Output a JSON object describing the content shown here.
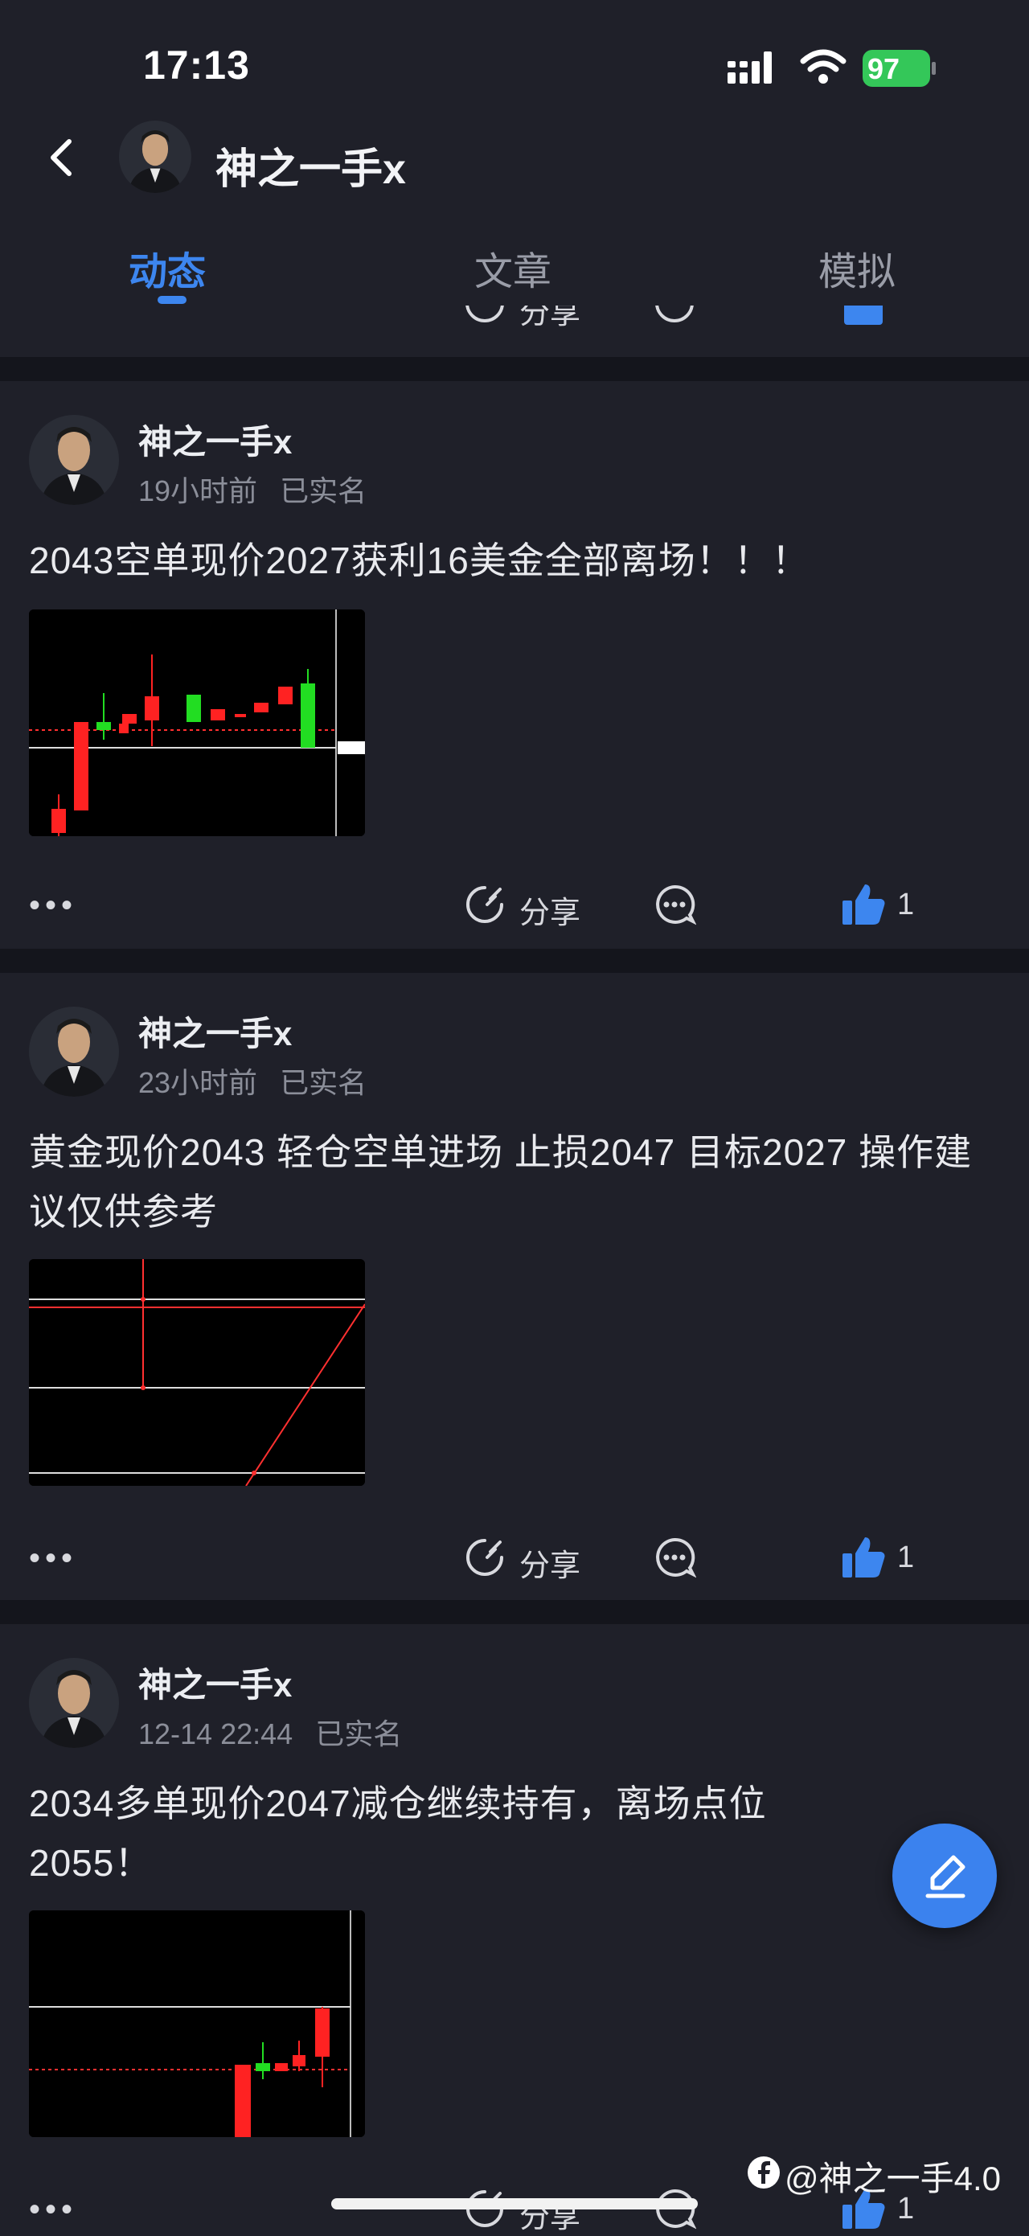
{
  "status_bar": {
    "time": "17:13",
    "battery": "97"
  },
  "header": {
    "title": "神之一手x"
  },
  "tabs": [
    {
      "label": "动态",
      "active": true
    },
    {
      "label": "文章",
      "active": false
    },
    {
      "label": "模拟",
      "active": false
    }
  ],
  "actions": {
    "share_label": "分享",
    "more": "•••"
  },
  "posts": [
    {
      "author": "神之一手x",
      "time": "19小时前",
      "verified": "已实名",
      "content": "2043空单现价2027获利16美金全部离场！！！",
      "likes": "1"
    },
    {
      "author": "神之一手x",
      "time": "23小时前",
      "verified": "已实名",
      "content": "黄金现价2043 轻仓空单进场 止损2047 目标2027 操作建议仅供参考",
      "likes": "1"
    },
    {
      "author": "神之一手x",
      "time": "12-14 22:44",
      "verified": "已实名",
      "content": "2034多单现价2047减仓继续持有，离场点位2055！",
      "likes": "1"
    }
  ],
  "watermark": "@神之一手4.0",
  "colors": {
    "accent": "#3d86ef",
    "background": "#1f2029",
    "divider": "#14151c"
  }
}
